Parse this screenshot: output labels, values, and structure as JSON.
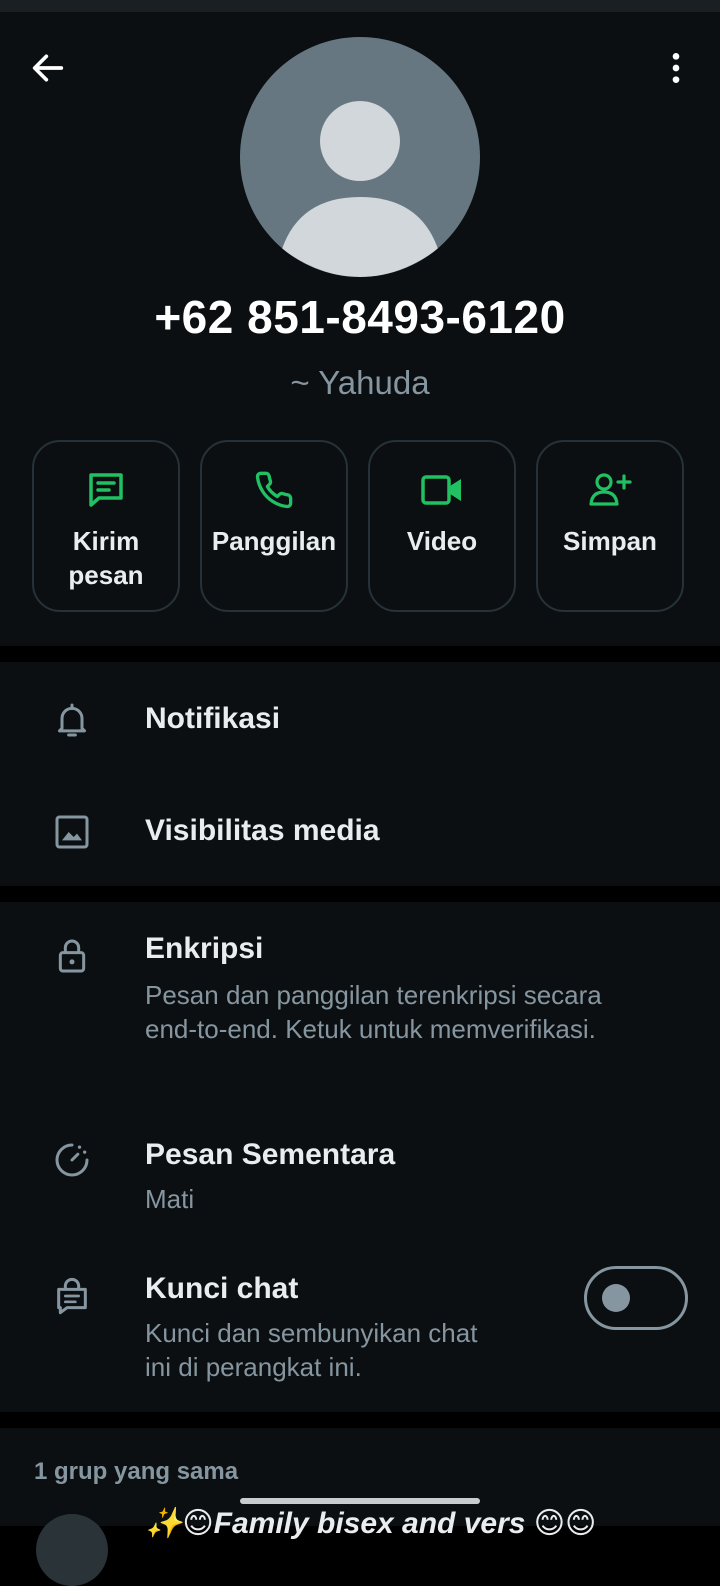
{
  "contact": {
    "phone": "+62 851-8493-6120",
    "pushname": "~ Yahuda"
  },
  "actions": [
    {
      "label": "Kirim\npesan",
      "icon": "message-icon"
    },
    {
      "label": "Panggilan",
      "icon": "phone-icon"
    },
    {
      "label": "Video",
      "icon": "video-icon"
    },
    {
      "label": "Simpan",
      "icon": "add-contact-icon"
    }
  ],
  "settings": {
    "notifications": {
      "title": "Notifikasi",
      "icon": "bell-icon"
    },
    "media_visibility": {
      "title": "Visibilitas media",
      "icon": "image-icon"
    },
    "encryption": {
      "title": "Enkripsi",
      "subtitle": "Pesan dan panggilan terenkripsi secara end-to-end. Ketuk untuk memverifikasi.",
      "icon": "lock-icon"
    },
    "disappearing": {
      "title": "Pesan Sementara",
      "subtitle": "Mati",
      "icon": "timer-icon"
    },
    "chat_lock": {
      "title": "Kunci chat",
      "subtitle": "Kunci dan sembunyikan chat ini di perangkat ini.",
      "icon": "chat-lock-icon",
      "enabled": false
    }
  },
  "groups": {
    "header": "1 grup yang sama",
    "items": [
      {
        "name": "✨😊Family bisex and vers 😊😊"
      }
    ]
  },
  "colors": {
    "accent": "#21c063",
    "background": "#0b0f12",
    "text": "#e9edef",
    "muted": "#8696a0",
    "avatar": "#667781"
  }
}
